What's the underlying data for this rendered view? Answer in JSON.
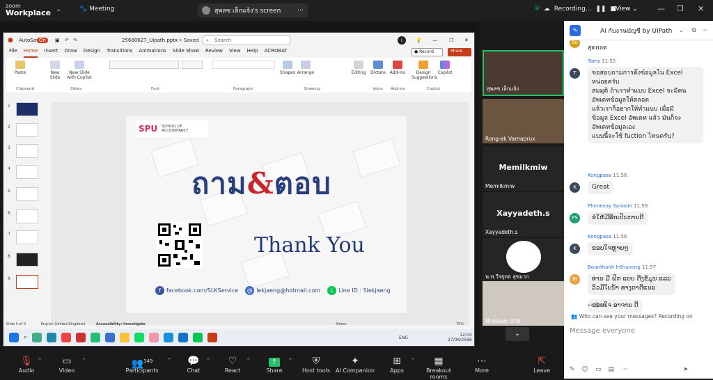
{
  "topbar": {
    "zoom_small": "zoom",
    "zoom_big": "Workplace",
    "meeting": "Meeting",
    "share_label": "สุพลซ เล็กแจ้ง's screen",
    "recording": "Recording...",
    "view": "View"
  },
  "ppt": {
    "autosave": "AutoSave",
    "autosave_state": "On",
    "filename": "25680627_Uipath.pptx • Saved",
    "search_placeholder": "Search",
    "menus": [
      "File",
      "Home",
      "Insert",
      "Draw",
      "Design",
      "Transitions",
      "Animations",
      "Slide Show",
      "Review",
      "View",
      "Help",
      "ACROBAT"
    ],
    "record": "Record",
    "share": "Share",
    "ribbon": [
      "Paste",
      "New Slide",
      "New Slide with Copilot",
      "Shapes",
      "Arrange",
      "Editing",
      "Dictate",
      "Add-ins",
      "Design Suggestions",
      "Copilot"
    ],
    "groups": [
      "Clipboard",
      "Slides",
      "Font",
      "Paragraph",
      "Drawing",
      "Voice",
      "Add-ins",
      "Copilot"
    ],
    "slide_numbers": [
      "1",
      "2",
      "3",
      "4",
      "5",
      "6",
      "7",
      "8",
      "9"
    ],
    "slide": {
      "logo_spu": "SPU",
      "logo_school": "SCHOOL OF ACCOUNTANCY",
      "qa_left": "ถาม",
      "qa_amp": "&",
      "qa_right": "ตอบ",
      "thanks": "Thank You",
      "facebook": "facebook.com/SLKService",
      "email": "lekjaeng@hotmail.com",
      "line": "Line ID : Slekjaeng"
    },
    "status_left": "Slide 9 of 9",
    "status_lang": "English (United Kingdom)",
    "status_access": "Accessibility: Investigate",
    "status_notes": "Notes",
    "zoom": "79%",
    "taskbar_lang": "ENG",
    "taskbar_time": "12:04",
    "taskbar_date": "27/06/2568"
  },
  "participants": [
    {
      "name": "สุพลซ เล็กแจ้ง",
      "big": ""
    },
    {
      "name": "Rong-ek Varnaprux",
      "big": ""
    },
    {
      "name": "Memilkmiw",
      "big": "Memilkmiw"
    },
    {
      "name": "Xayyadeth.s",
      "big": "Xayyadeth.s"
    },
    {
      "name": "พ.ท.วีรยุทธ สุขมาก",
      "big": ""
    },
    {
      "name": "Ninkham STB",
      "big": ""
    }
  ],
  "chat": {
    "title": "Ai กับงานบัญชี by UiPath",
    "messages": [
      {
        "sender": "",
        "time": "",
        "lines": [
          "สุดยอด"
        ],
        "initials": "Su",
        "color": "#d4a017"
      },
      {
        "sender": "Tamz",
        "time": "11:55",
        "lines": [
          "ขอสอบถามการดึงข้อมูลใน Excel",
          "หน่อยครับ",
          "สมมุติ ถ้าเราทำแบบ Excel จะมีคน",
          "อัพเดทข้อมูลให้ตลอด",
          "แล้วเราก็อยากให้ทำแบบ เมื่อมี",
          "ข้อมูล Excel อัพเดท แล้ว มันก็จะ",
          "อัพเดทข้อมูลเอง",
          "แบบนี้จะใช้ fuction ไหนครับ?"
        ],
        "initials": "T",
        "color": "#3b4a5a"
      },
      {
        "sender": "Kongpasa",
        "time": "11:56",
        "lines": [
          "Great"
        ],
        "initials": "K",
        "color": "#3b4a5a"
      },
      {
        "sender": "Phonexay Sanasin",
        "time": "11:56",
        "lines": [
          "ຂໍໃຫ້ມີອີກເປັນການດີ"
        ],
        "initials": "PS",
        "color": "#1f9d6b"
      },
      {
        "sender": "Kongpasa",
        "time": "11:56",
        "lines": [
          "ຂອບໃຈຫຼາຍໆ"
        ],
        "initials": "K",
        "color": "#3b4a5a"
      },
      {
        "sender": "Bounthanh Inthavong",
        "time": "11:57",
        "lines": [
          "ທ່ານ ມີ ຝິກ ແບບ ດີງຂໍ້ມູນ ແລະ",
          "ວິວມີໃບນ້ຳ ທາງດາດີແນະ"
        ],
        "initials": "BI",
        "color": "#e8a33c"
      },
      {
        "sender": "",
        "time": "",
        "lines": [
          "ຂອບໃຈ ອາຈານ ດີ"
        ],
        "initials": "",
        "color": ""
      }
    ],
    "note": "Who can see your messages? Recording on",
    "input_placeholder": "Message everyone"
  },
  "controls": {
    "audio": "Audio",
    "video": "Video",
    "participants": "Participants",
    "participants_count": "349",
    "chat": "Chat",
    "react": "React",
    "share": "Share",
    "host_tools": "Host tools",
    "ai_companion": "AI Companion",
    "apps": "Apps",
    "breakout": "Breakout rooms",
    "more": "More",
    "leave": "Leave"
  }
}
